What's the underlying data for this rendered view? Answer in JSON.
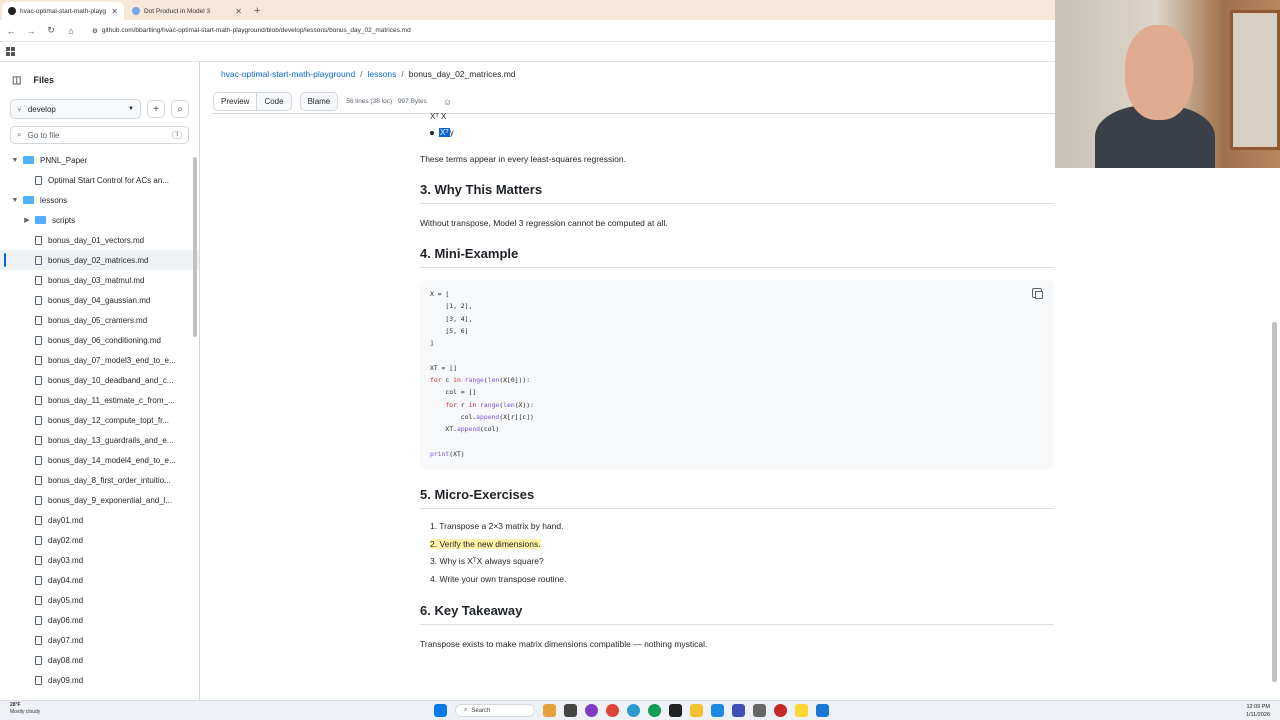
{
  "browser": {
    "tabs": [
      {
        "title": "hvac-optimal-start-math-playg",
        "active": true
      },
      {
        "title": "Dot Product in Model 3",
        "active": false
      }
    ],
    "url": "github.com/bbartling/hvac-optimal-start-math-playground/blob/develop/lessons/bonus_day_02_matrices.md"
  },
  "sidebar": {
    "title": "Files",
    "branch": "develop",
    "goto_placeholder": "Go to file",
    "goto_key": "t",
    "tree": [
      {
        "label": "PNNL_Paper",
        "type": "folder",
        "depth": 0,
        "expanded": true
      },
      {
        "label": "Optimal Start Control for ACs an...",
        "type": "file",
        "depth": 1
      },
      {
        "label": "lessons",
        "type": "folder",
        "depth": 0,
        "expanded": true
      },
      {
        "label": "scripts",
        "type": "folder",
        "depth": 1,
        "expanded": false
      },
      {
        "label": "bonus_day_01_vectors.md",
        "type": "file",
        "depth": 1
      },
      {
        "label": "bonus_day_02_matrices.md",
        "type": "file",
        "depth": 1,
        "selected": true
      },
      {
        "label": "bonus_day_03_matmul.md",
        "type": "file",
        "depth": 1
      },
      {
        "label": "bonus_day_04_gaussian.md",
        "type": "file",
        "depth": 1
      },
      {
        "label": "bonus_day_05_cramers.md",
        "type": "file",
        "depth": 1
      },
      {
        "label": "bonus_day_06_conditioning.md",
        "type": "file",
        "depth": 1
      },
      {
        "label": "bonus_day_07_model3_end_to_e...",
        "type": "file",
        "depth": 1
      },
      {
        "label": "bonus_day_10_deadband_and_c...",
        "type": "file",
        "depth": 1
      },
      {
        "label": "bonus_day_11_estimate_c_from_...",
        "type": "file",
        "depth": 1
      },
      {
        "label": "bonus_day_12_compute_topt_fr...",
        "type": "file",
        "depth": 1
      },
      {
        "label": "bonus_day_13_guardrails_and_e...",
        "type": "file",
        "depth": 1
      },
      {
        "label": "bonus_day_14_model4_end_to_e...",
        "type": "file",
        "depth": 1
      },
      {
        "label": "bonus_day_8_first_order_intuitio...",
        "type": "file",
        "depth": 1
      },
      {
        "label": "bonus_day_9_exponential_and_l...",
        "type": "file",
        "depth": 1
      },
      {
        "label": "day01.md",
        "type": "file",
        "depth": 1
      },
      {
        "label": "day02.md",
        "type": "file",
        "depth": 1
      },
      {
        "label": "day03.md",
        "type": "file",
        "depth": 1
      },
      {
        "label": "day04.md",
        "type": "file",
        "depth": 1
      },
      {
        "label": "day05.md",
        "type": "file",
        "depth": 1
      },
      {
        "label": "day06.md",
        "type": "file",
        "depth": 1
      },
      {
        "label": "day07.md",
        "type": "file",
        "depth": 1
      },
      {
        "label": "day08.md",
        "type": "file",
        "depth": 1
      },
      {
        "label": "day09.md",
        "type": "file",
        "depth": 1
      }
    ]
  },
  "breadcrumb": {
    "repo": "hvac-optimal-start-math-playground",
    "folder": "lessons",
    "file": "bonus_day_02_matrices.md"
  },
  "filebar": {
    "preview": "Preview",
    "code": "Code",
    "blame": "Blame",
    "info": "56 lines (38 loc) · 997 Bytes"
  },
  "doc": {
    "bullet_cut": "Xᵀ X",
    "bullet_hl": "Xᵀ",
    "bullet_rest": "y",
    "intro": "These terms appear in every least-squares regression.",
    "h3": "3. Why This Matters",
    "p3": "Without transpose, Model 3 regression cannot be computed at all.",
    "h4": "4. Mini-Example",
    "h5": "5. Micro-Exercises",
    "exercises": [
      "1. Transpose a 2×3 matrix by hand.",
      "2. Verify the new dimensions.",
      "3. Why is XᵀX always square?",
      "4. Write your own transpose routine."
    ],
    "h6": "6. Key Takeaway",
    "p6": "Transpose exists to make matrix dimensions compatible — nothing mystical."
  },
  "taskbar": {
    "temp": "28°F",
    "weather": "Mostly cloudy",
    "search": "Search",
    "time": "12:09 PM",
    "date": "1/11/2026"
  }
}
